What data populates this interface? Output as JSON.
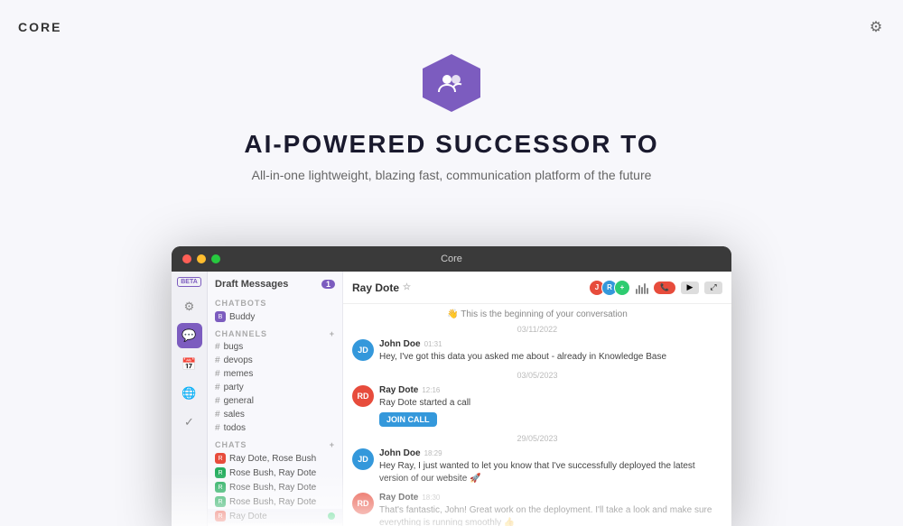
{
  "header": {
    "logo": "CORE",
    "settings_icon": "⚙"
  },
  "hero": {
    "title": "AI-POWERED SUCCESSOR TO",
    "subtitle": "All-in-one lightweight, blazing fast, communication platform of the future"
  },
  "app": {
    "window_title": "Core",
    "icon_sidebar": {
      "beta": "BETA",
      "icons": [
        "⚙",
        "💬",
        "📅",
        "🌐",
        "✓"
      ]
    },
    "channel_sidebar": {
      "draft_messages": "Draft Messages",
      "draft_count": "1",
      "sections": {
        "chatbots": "CHATBOTS",
        "channels": "CHANNELS",
        "chats": "CHATS"
      },
      "chatbot_item": "Buddy",
      "channels": [
        "bugs",
        "devops",
        "memes",
        "party",
        "general",
        "sales",
        "todos"
      ],
      "chats": [
        "Ray Dote, Rose Bush",
        "Rose Bush, Ray Dote",
        "Rose Bush, Ray Dote",
        "Rose Bush, Ray Dote",
        "Ray Dote"
      ]
    },
    "chat": {
      "contact_name": "Ray Dote",
      "messages": [
        {
          "type": "start",
          "text": "👋 This is the beginning of your conversation"
        },
        {
          "date": "03/11/2022",
          "sender": "John Doe",
          "time": "01:31",
          "avatar_text": "JD",
          "avatar_color": "#3498db",
          "text": "Hey, I've got this data you asked me about - already in Knowledge Base"
        },
        {
          "date": "03/05/2023",
          "sender": "Ray Dote",
          "time": "12:16",
          "avatar_text": "RD",
          "avatar_color": "#e74c3c",
          "text": "Ray Dote started a call",
          "has_join_btn": true,
          "join_btn_label": "JOIN CALL"
        },
        {
          "date": "29/05/2023",
          "sender": "John Doe",
          "time": "18:29",
          "avatar_text": "JD",
          "avatar_color": "#3498db",
          "text": "Hey Ray, I just wanted to let you know that I've successfully deployed the latest version of our website 🚀"
        },
        {
          "sender": "Ray Dote",
          "time": "18:30",
          "avatar_text": "RD",
          "avatar_color": "#e74c3c",
          "text": "That's fantastic, John! Great work on the deployment. I'll take a look and make sure everything is running smoothly 👍"
        }
      ]
    }
  }
}
